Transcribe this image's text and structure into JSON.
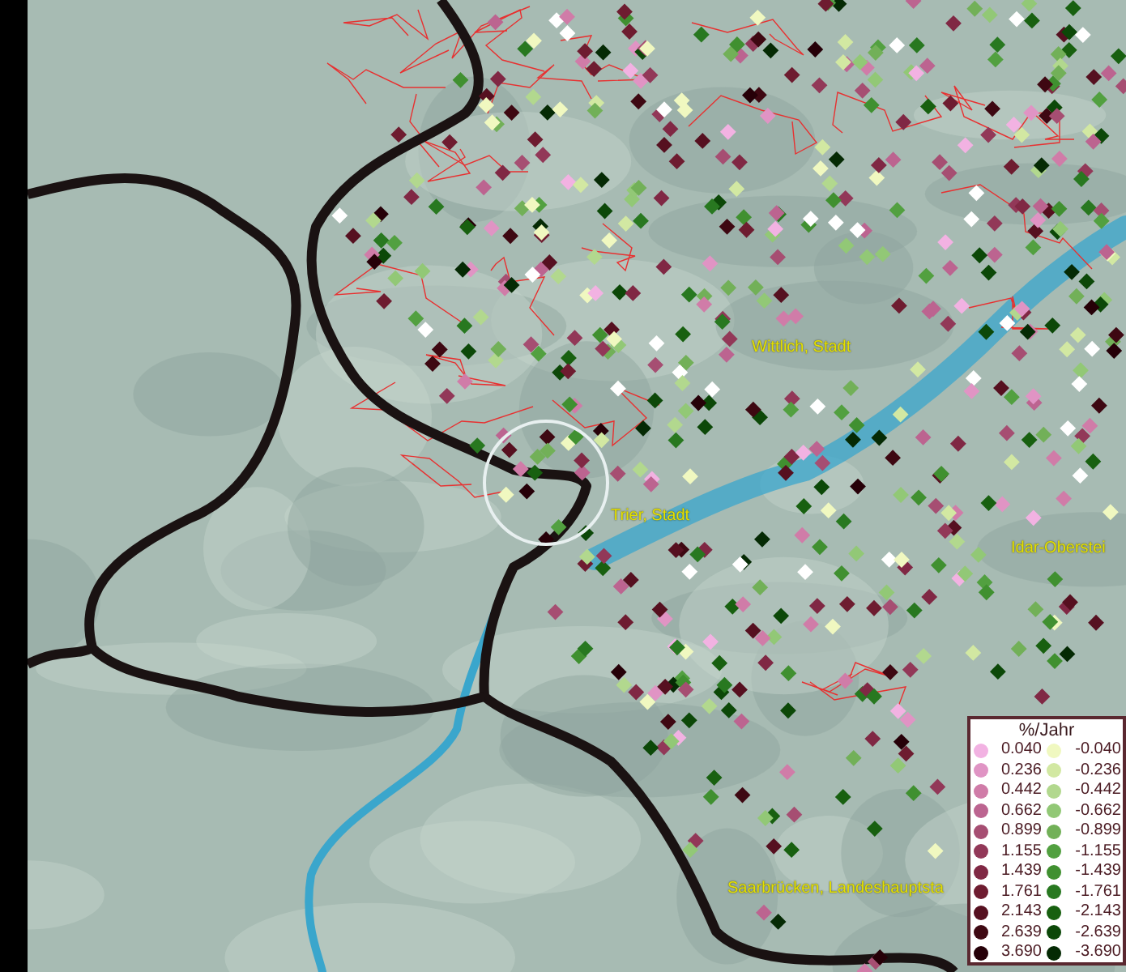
{
  "map": {
    "place_labels": [
      {
        "text": "Wittlich, Stadt"
      },
      {
        "text": "Trier, Stadt"
      },
      {
        "text": "Idar-Oberstei"
      },
      {
        "text": "Saarbrücken, Landeshauptsta"
      }
    ]
  },
  "legend": {
    "title": "%/Jahr",
    "positive": [
      {
        "value": "0.040",
        "color": "#f2b2e2"
      },
      {
        "value": "0.236",
        "color": "#e094c4"
      },
      {
        "value": "0.442",
        "color": "#d07ca8"
      },
      {
        "value": "0.662",
        "color": "#bc6490"
      },
      {
        "value": "0.899",
        "color": "#a64e72"
      },
      {
        "value": "1.155",
        "color": "#923858"
      },
      {
        "value": "1.439",
        "color": "#802844"
      },
      {
        "value": "1.761",
        "color": "#6e1c30"
      },
      {
        "value": "2.143",
        "color": "#561020"
      },
      {
        "value": "2.639",
        "color": "#3e0812"
      },
      {
        "value": "3.690",
        "color": "#260008"
      }
    ],
    "negative": [
      {
        "value": "-0.040",
        "color": "#f0f8c0"
      },
      {
        "value": "-0.236",
        "color": "#d2e8a2"
      },
      {
        "value": "-0.442",
        "color": "#b2d88e"
      },
      {
        "value": "-0.662",
        "color": "#92c876"
      },
      {
        "value": "-0.899",
        "color": "#72b058"
      },
      {
        "value": "-1.155",
        "color": "#52a040"
      },
      {
        "value": "-1.439",
        "color": "#409030"
      },
      {
        "value": "-1.761",
        "color": "#287820"
      },
      {
        "value": "-2.143",
        "color": "#186010"
      },
      {
        "value": "-2.639",
        "color": "#0c4808"
      },
      {
        "value": "-3.690",
        "color": "#052a04"
      }
    ]
  }
}
